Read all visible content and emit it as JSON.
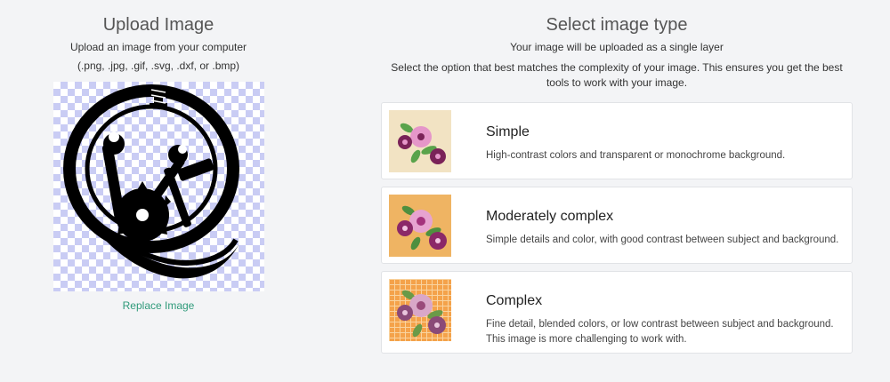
{
  "upload": {
    "title": "Upload Image",
    "line1": "Upload an image from your computer",
    "line2": "(.png, .jpg, .gif, .svg, .dxf, or .bmp)",
    "replace_label": "Replace Image"
  },
  "select": {
    "title": "Select image type",
    "line1": "Your image will be uploaded as a single layer",
    "line2": "Select the option that best matches the complexity of your image. This ensures you get the best tools to work with your image."
  },
  "options": [
    {
      "title": "Simple",
      "desc": "High-contrast colors and transparent or monochrome background.",
      "thumb_bg": "#f2e3c3"
    },
    {
      "title": "Moderately complex",
      "desc": "Simple details and color, with good contrast between subject and background.",
      "thumb_bg": "#efb463"
    },
    {
      "title": "Complex",
      "desc": "Fine detail, blended colors, or low contrast between subject and background. This image is more challenging to work with.",
      "thumb_bg": "#f4a24a"
    }
  ],
  "colors": {
    "accent_link": "#2f9a7a",
    "checker": "#c9ccf4",
    "page_bg": "#f3f4f6"
  }
}
